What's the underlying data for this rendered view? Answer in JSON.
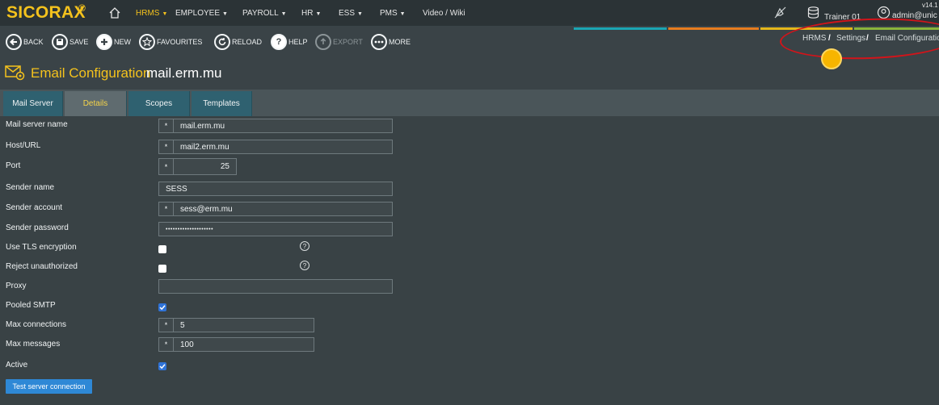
{
  "app": {
    "brand": "SICORAX",
    "brand_mark": "®",
    "version": "v14.1"
  },
  "nav": [
    {
      "label": "HRMS",
      "has_menu": true,
      "active": true
    },
    {
      "label": "EMPLOYEE",
      "has_menu": true
    },
    {
      "label": "PAYROLL",
      "has_menu": true
    },
    {
      "label": "HR",
      "has_menu": true
    },
    {
      "label": "ESS",
      "has_menu": true
    },
    {
      "label": "PMS",
      "has_menu": true
    },
    {
      "label": "Video / Wiki",
      "has_menu": false
    }
  ],
  "nav_caret": "▼",
  "user": {
    "database": "Trainer 01",
    "account": "admin@unic"
  },
  "toolbar": {
    "back": "BACK",
    "save": "SAVE",
    "new": "NEW",
    "favourites": "FAVOURITES",
    "reload": "RELOAD",
    "help": "HELP",
    "export": "EXPORT",
    "more": "MORE"
  },
  "breadcrumb": [
    "HRMS",
    "Settings",
    "Email Configuration"
  ],
  "breadcrumb_sep": "/",
  "page": {
    "title": "Email Configuration",
    "subtitle": "mail.erm.mu"
  },
  "tabs": [
    "Mail Server",
    "Details",
    "Scopes",
    "Templates"
  ],
  "active_tab": "Details",
  "form": {
    "required_mark": "*",
    "help_glyph": "?",
    "mail_server_name": {
      "label": "Mail server name",
      "value": "mail.erm.mu"
    },
    "host_url": {
      "label": "Host/URL",
      "value": "mail2.erm.mu"
    },
    "port": {
      "label": "Port",
      "value": "25"
    },
    "sender_name": {
      "label": "Sender name",
      "value": "SESS"
    },
    "sender_account": {
      "label": "Sender account",
      "value": "sess@erm.mu"
    },
    "sender_password": {
      "label": "Sender password",
      "value": "••••••••••••••••••••"
    },
    "use_tls": {
      "label": "Use TLS encryption",
      "checked": false
    },
    "reject_unauthorized": {
      "label": "Reject unauthorized",
      "checked": false
    },
    "proxy": {
      "label": "Proxy",
      "value": ""
    },
    "pooled_smtp": {
      "label": "Pooled SMTP",
      "checked": true
    },
    "max_connections": {
      "label": "Max connections",
      "value": "5"
    },
    "max_messages": {
      "label": "Max messages",
      "value": "100"
    },
    "active": {
      "label": "Active",
      "checked": true
    }
  },
  "test_button": "Test server connection",
  "colors": {
    "accent": "#f4c21d",
    "tab_bg": "#2f6170",
    "button_blue": "#2e88d6",
    "stripe_teal": "#1aa6b3",
    "stripe_orange": "#e67c1e",
    "stripe_yellow": "#e4b71a",
    "stripe_green": "#8ab43b"
  }
}
